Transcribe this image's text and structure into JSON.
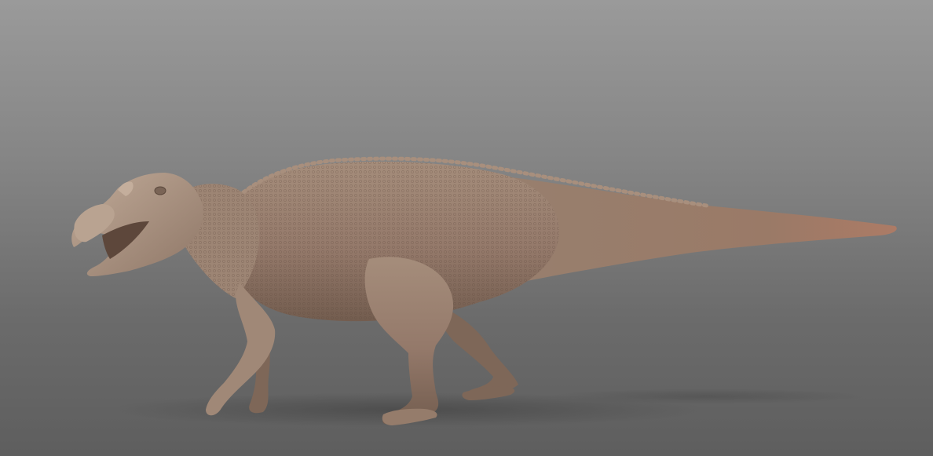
{
  "scene": {
    "subject_icon": "dinosaur-sculpt-icon",
    "colors": {
      "background_top": "#9a9a9a",
      "background_bottom": "#5e5e5e",
      "skin_light": "#b29a88",
      "skin_mid": "#9b8270",
      "skin_dark": "#6e5849",
      "tail_tip": "#a97a66",
      "shadow": "#4a4a4a"
    }
  }
}
